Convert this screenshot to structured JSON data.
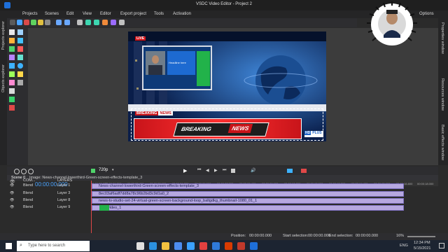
{
  "window": {
    "title": "VSDC Video Editor - Project 2",
    "options_label": "Options"
  },
  "menu": [
    "Projects",
    "Scenes",
    "Edit",
    "View",
    "Editor",
    "Export project",
    "Tools",
    "Activation"
  ],
  "left_panels": [
    "Projects explorer",
    "Objects explorer"
  ],
  "right_panels": [
    "Properties window",
    "Resources window",
    "Basic effects window"
  ],
  "scene": {
    "live_badge": "LIVE",
    "pip_label": "Headline here",
    "breaking_tag": "BREAKING",
    "news_tag": "NEWS",
    "banner_breaking": "BREAKING",
    "banner_news": "NEWS",
    "channel_logo": "HD",
    "channel_suffix": "PLUS"
  },
  "playback": {
    "resolution": "720p"
  },
  "timeline": {
    "tabs": [
      "Scene 0",
      "Image: News-channel-lowerthird-Green-screen-effects-template_3"
    ],
    "time": "00:00:00.000",
    "header_com": "COM...",
    "header_layers": "LAYERS",
    "ruler": [
      "00:00:00.000",
      "00:00:01.200",
      "00:00:02.400",
      "00:00:03.600",
      "00:00:04.800",
      "00:00:06.000",
      "00:00:07.200",
      "00:00:08.400",
      "00:00:09.600",
      "00:00:10.800",
      "00:00:12.000",
      "00:00:13.200",
      "00:00:14.400",
      "00:00:15.600",
      "00:00:16.800",
      "00:00:18.000"
    ],
    "tracks": [
      {
        "blend": "Blend",
        "layer": "Layer 1",
        "clip": "News-channel-lowerthird-Green-screen-effects-template_3"
      },
      {
        "blend": "Blend",
        "layer": "Layer 3",
        "clip": "8ec03af6adf7dd8a78c96b2bd3c9d1a0_2"
      },
      {
        "blend": "Blend",
        "layer": "Layer 8",
        "clip": "news-tv-studio-set-24-virtual-green-screen-background-loop_baltgdkg_thumbnail-1080_01_1"
      },
      {
        "blend": "Blend",
        "layer": "Layer 9",
        "clip": "video_1"
      }
    ]
  },
  "status": {
    "position_label": "Position:",
    "position_value": "00:00:00.000",
    "start_label": "Start selection:",
    "start_value": "00:00:00.000",
    "end_label": "End selection:",
    "end_value": "00:00:00.000",
    "zoom": "16%"
  },
  "taskbar": {
    "search_placeholder": "Type here to search",
    "language": "ENG",
    "time": "12:34 PM",
    "date": "5/15/2021"
  }
}
